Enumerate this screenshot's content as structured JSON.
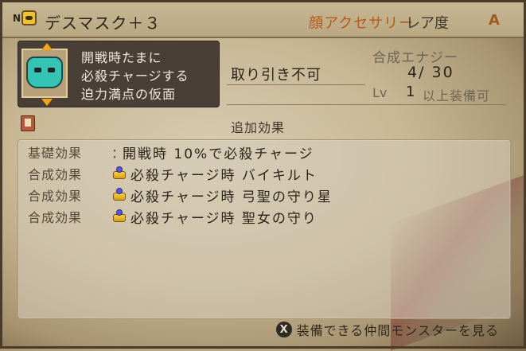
{
  "header": {
    "n_badge": "N",
    "item_name": "デスマスク＋３",
    "rarity_type": "顔アクセサリー",
    "rarity_label": "レア度",
    "rarity_grade": "A"
  },
  "description": {
    "line1": "開戦時たまに",
    "line2": "必殺チャージする",
    "line3": "迫力満点の仮面"
  },
  "info": {
    "trade": "取り引き不可",
    "energy_label": "合成エナジー",
    "energy_value": "4/ 30",
    "lv_label": "Lv",
    "lv_value": "1",
    "lv_text": "以上装備可"
  },
  "effects": {
    "title": "追加効果",
    "rows": [
      {
        "label": "基礎効果",
        "sep": "：",
        "text": "開戦時 10%で必殺チャージ"
      },
      {
        "label": "合成効果",
        "text": "必殺チャージ時 バイキルト"
      },
      {
        "label": "合成効果",
        "text": "必殺チャージ時 弓聖の守り星"
      },
      {
        "label": "合成効果",
        "text": "必殺チャージ時 聖女の守り"
      }
    ]
  },
  "footer": {
    "button_glyph": "X",
    "label": "装備できる仲間モンスターを見る"
  }
}
